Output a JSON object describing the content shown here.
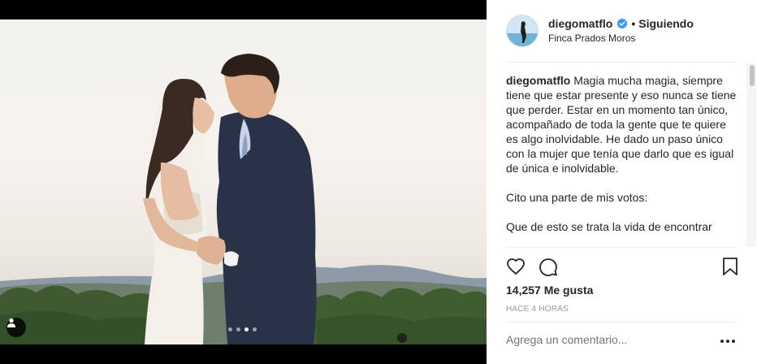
{
  "post": {
    "photo_subject": "wedding couple photo",
    "carousel": {
      "count": 4,
      "active_index": 2
    }
  },
  "header": {
    "username": "diegomatflo",
    "verified": true,
    "separator": "•",
    "follow_status": "Siguiendo",
    "location": "Finca Prados Moros"
  },
  "caption": {
    "username": "diegomatflo",
    "text": "Magia mucha magia, siempre tiene que estar presente y eso nunca se tiene que perder. Estar en un momento tan único, acompañado de toda la gente que te quiere es algo inolvidable. He dado un paso único con la mujer que tenía que darlo que es igual de única e inolvidable.\n\nCito una parte de mis votos:\n\nQue de esto se trata la vida de encontrar"
  },
  "stats": {
    "likes": "14,257 Me gusta",
    "time_ago": "HACE 4 HORAS"
  },
  "comment_box": {
    "placeholder": "Agrega un comentario..."
  },
  "icons": {
    "like": "heart-icon",
    "comment": "comment-icon",
    "save": "bookmark-icon",
    "tag": "user-tag-icon",
    "more": "more-options-icon"
  },
  "colors": {
    "verified_blue": "#3897f0",
    "text": "#262626",
    "muted": "#999999"
  }
}
